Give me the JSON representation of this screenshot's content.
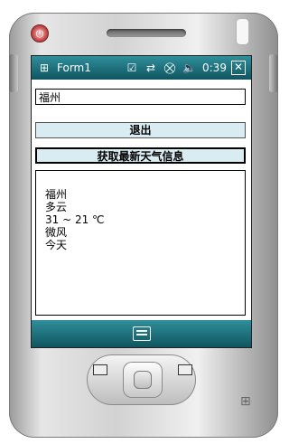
{
  "window": {
    "title": "Form1",
    "time": "0:39",
    "status_icons": [
      "checkbox-icon",
      "sync-icon",
      "signal-off-icon",
      "volume-icon"
    ],
    "close_label": "✕"
  },
  "form": {
    "city_value": "福州",
    "exit_button": "退出",
    "get_weather_button": "获取最新天气信息",
    "output_lines": [
      "福州",
      "多云",
      "31 ~ 21 ℃",
      "微风",
      "今天"
    ]
  }
}
